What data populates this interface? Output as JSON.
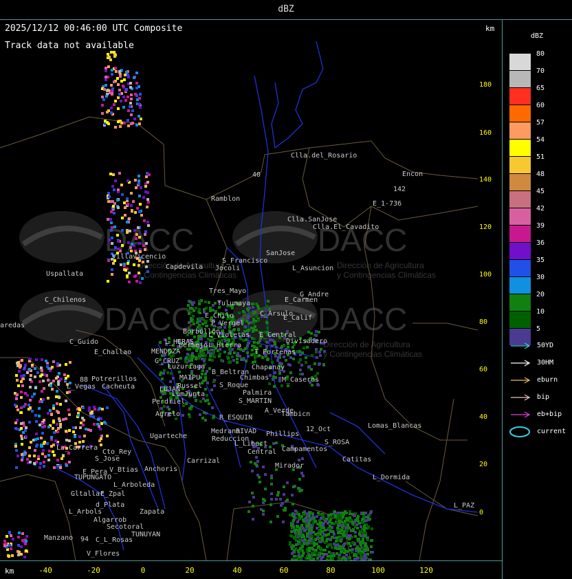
{
  "header": {
    "title": "dBZ",
    "timestamp": "2025/12/12 00:46:00 UTC Composite",
    "track_status": "Track data not available",
    "km_top": "km",
    "km_bottom": "km"
  },
  "legend": {
    "unit": "dBZ",
    "bins": [
      {
        "label": "80",
        "color": "#d8d8d8"
      },
      {
        "label": "70",
        "color": "#b8b8b8"
      },
      {
        "label": "65",
        "color": "#ff3020"
      },
      {
        "label": "60",
        "color": "#ff6a00"
      },
      {
        "label": "57",
        "color": "#ff9a60"
      },
      {
        "label": "54",
        "color": "#ffff00"
      },
      {
        "label": "51",
        "color": "#f8c830"
      },
      {
        "label": "48",
        "color": "#d08a40"
      },
      {
        "label": "45",
        "color": "#c87080"
      },
      {
        "label": "42",
        "color": "#d860a0"
      },
      {
        "label": "39",
        "color": "#c81890"
      },
      {
        "label": "36",
        "color": "#7010c8"
      },
      {
        "label": "35",
        "color": "#2050e8"
      },
      {
        "label": "30",
        "color": "#1090e0"
      },
      {
        "label": "20",
        "color": "#108010"
      },
      {
        "label": "10",
        "color": "#006000"
      },
      {
        "label": "5",
        "color": "#4a3a90"
      }
    ]
  },
  "tracks": [
    {
      "label": "50YD",
      "color": "#40d0d8",
      "icon": "arrow-right-icon"
    },
    {
      "label": "30HM",
      "color": "#ffffff",
      "icon": "arrow-right-icon"
    },
    {
      "label": "eburn",
      "color": "#f0c060",
      "icon": "arrow-right-icon"
    },
    {
      "label": "bip",
      "color": "#f0c0c0",
      "icon": "arrow-right-icon"
    },
    {
      "label": "eb+bip",
      "color": "#e040e0",
      "icon": "arrow-right-icon"
    },
    {
      "label": "current",
      "color": "#40d0e0",
      "icon": "ellipse-icon"
    }
  ],
  "axes": {
    "y_ticks": [
      "180",
      "160",
      "140",
      "120",
      "100",
      "80",
      "60",
      "40",
      "20",
      "0"
    ],
    "x_ticks": [
      "-40",
      "-20",
      "0",
      "20",
      "40",
      "60",
      "80",
      "100",
      "120"
    ]
  },
  "watermark": {
    "text": "DACC",
    "subtitle_1": "Dirección de Agricultura",
    "subtitle_2": "y Contingencias Climáticas"
  },
  "places": [
    {
      "name": "Clla.del_Rosario"
    },
    {
      "name": "Encon"
    },
    {
      "name": "142"
    },
    {
      "name": "E_1-736"
    },
    {
      "name": "Ramblon"
    },
    {
      "name": "40"
    },
    {
      "name": "Clla.SanJose"
    },
    {
      "name": "Clla.El_Cavadito"
    },
    {
      "name": "Villavicencio"
    },
    {
      "name": "Capdevila"
    },
    {
      "name": "S_Francisco"
    },
    {
      "name": "Jocoli"
    },
    {
      "name": "SanJose"
    },
    {
      "name": "L_Asuncion"
    },
    {
      "name": "Uspallata"
    },
    {
      "name": "Tres_Mayo"
    },
    {
      "name": "G_Andre"
    },
    {
      "name": "C_Chilenos"
    },
    {
      "name": "Tulumaya"
    },
    {
      "name": "E_Carmen"
    },
    {
      "name": "E_Chilo"
    },
    {
      "name": "C_Arsulo"
    },
    {
      "name": "P_Vergel"
    },
    {
      "name": "E_Calif"
    },
    {
      "name": "aredas"
    },
    {
      "name": "L_Violetas"
    },
    {
      "name": "Borbollon"
    },
    {
      "name": "E_Central"
    },
    {
      "name": "Divisadero"
    },
    {
      "name": "C_Guido"
    },
    {
      "name": "L_HERAS"
    },
    {
      "name": "Bermejo"
    },
    {
      "name": "E_Challao"
    },
    {
      "name": "MENDOZA"
    },
    {
      "name": "L_Hierra"
    },
    {
      "name": "T_Fortenas"
    },
    {
      "name": "G_CRUZ"
    },
    {
      "name": "Luzuriaga"
    },
    {
      "name": "Chapanay"
    },
    {
      "name": "B_Beltran"
    },
    {
      "name": "MAIPU"
    },
    {
      "name": "Chimbas"
    },
    {
      "name": "M_Caseros"
    },
    {
      "name": "Potrerillos"
    },
    {
      "name": "Russel"
    },
    {
      "name": "L_Vegas"
    },
    {
      "name": "Cacheuta"
    },
    {
      "name": "LUJAN"
    },
    {
      "name": "LumJunta"
    },
    {
      "name": "S_Roque"
    },
    {
      "name": "Palmira"
    },
    {
      "name": "S_MARTIN"
    },
    {
      "name": "Perdriel"
    },
    {
      "name": "A_Verde"
    },
    {
      "name": "Tambicn"
    },
    {
      "name": "Agrelo"
    },
    {
      "name": "R_ESQUIN"
    },
    {
      "name": "Lomas_Blancas"
    },
    {
      "name": "Ugarteche"
    },
    {
      "name": "Medrano"
    },
    {
      "name": "RIVAD"
    },
    {
      "name": "Phillips"
    },
    {
      "name": "12_Oct"
    },
    {
      "name": "Reduccion"
    },
    {
      "name": "S_ROSA"
    },
    {
      "name": "La_Carrera"
    },
    {
      "name": "L_Libert"
    },
    {
      "name": "Cto_Rey"
    },
    {
      "name": "Campamentos"
    },
    {
      "name": "Central"
    },
    {
      "name": "S_Jose"
    },
    {
      "name": "Carrizal"
    },
    {
      "name": "Catitas"
    },
    {
      "name": "V_Btias"
    },
    {
      "name": "Anchoris"
    },
    {
      "name": "Mirador"
    },
    {
      "name": "E_Pera"
    },
    {
      "name": "TUPUNGATO"
    },
    {
      "name": "L_Dormida"
    },
    {
      "name": "L_Arboleda"
    },
    {
      "name": "Gltallar"
    },
    {
      "name": "E_Zpal"
    },
    {
      "name": "d_Plata"
    },
    {
      "name": "L_PAZ"
    },
    {
      "name": "L_Arbols"
    },
    {
      "name": "Zapata"
    },
    {
      "name": "Algarrob"
    },
    {
      "name": "Secotoral"
    },
    {
      "name": "TUNUYAN"
    },
    {
      "name": "Manzano"
    },
    {
      "name": "C_L_Rosas"
    },
    {
      "name": "V_Flores"
    },
    {
      "name": "88"
    },
    {
      "name": "94"
    }
  ]
}
